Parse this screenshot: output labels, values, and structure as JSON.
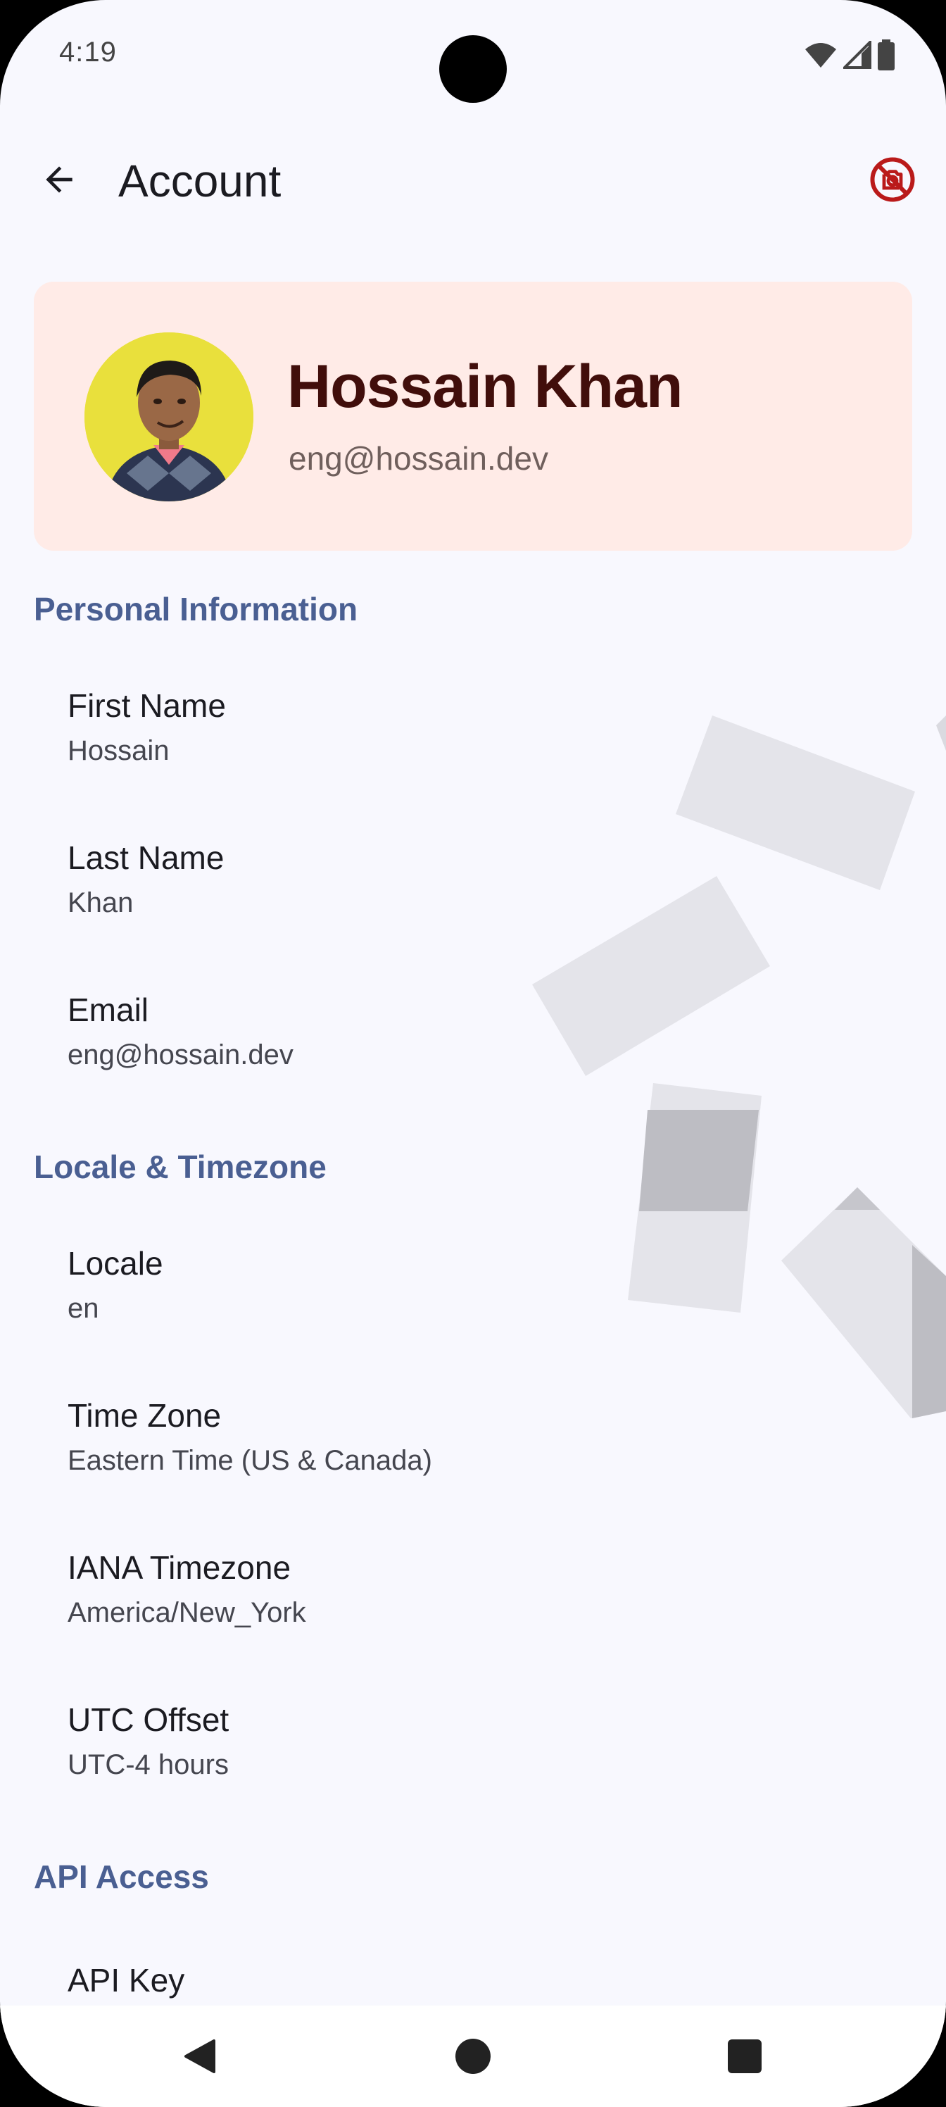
{
  "status_bar": {
    "time": "4:19"
  },
  "top_bar": {
    "title": "Account",
    "back_icon": "arrow-back-icon",
    "action_icon": "no-photography-icon",
    "action_color": "#ba1a1a"
  },
  "profile": {
    "name": "Hossain Khan",
    "email": "eng@hossain.dev",
    "card_color": "#ffebe7"
  },
  "sections": {
    "personal": "Personal Information",
    "locale": "Locale & Timezone",
    "api": "API Access"
  },
  "fields": {
    "first_name": {
      "label": "First Name",
      "value": "Hossain"
    },
    "last_name": {
      "label": "Last Name",
      "value": "Khan"
    },
    "email": {
      "label": "Email",
      "value": "eng@hossain.dev"
    },
    "locale": {
      "label": "Locale",
      "value": "en"
    },
    "time_zone": {
      "label": "Time Zone",
      "value": "Eastern Time (US & Canada)"
    },
    "iana_timezone": {
      "label": "IANA Timezone",
      "value": "America/New_York"
    },
    "utc_offset": {
      "label": "UTC Offset",
      "value": "UTC-4 hours"
    },
    "api_key": {
      "label": "API Key"
    }
  },
  "colors": {
    "accent": "#4a5f92",
    "background": "#f8f8fe"
  }
}
